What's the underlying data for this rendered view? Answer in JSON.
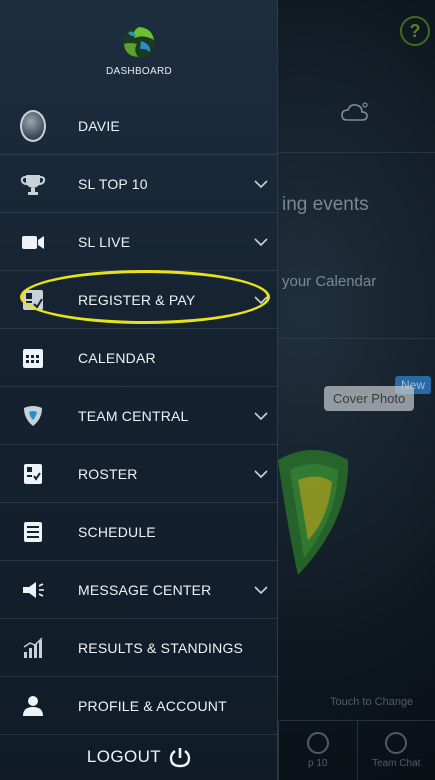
{
  "app": {
    "dashboard_label": "DASHBOARD",
    "brand_color": "#5aa32a",
    "highlight_color": "#e8e21a"
  },
  "menu": {
    "items": [
      {
        "label": "DAVIE",
        "icon": "avatar",
        "expandable": false
      },
      {
        "label": "SL TOP 10",
        "icon": "trophy-icon",
        "expandable": true
      },
      {
        "label": "SL LIVE",
        "icon": "video-camera-icon",
        "expandable": true
      },
      {
        "label": "REGISTER & PAY",
        "icon": "register-pay-icon",
        "expandable": true,
        "highlighted": true
      },
      {
        "label": "CALENDAR",
        "icon": "calendar-icon",
        "expandable": false
      },
      {
        "label": "TEAM CENTRAL",
        "icon": "team-shield-icon",
        "expandable": true
      },
      {
        "label": "ROSTER",
        "icon": "roster-icon",
        "expandable": true
      },
      {
        "label": "SCHEDULE",
        "icon": "schedule-list-icon",
        "expandable": false
      },
      {
        "label": "MESSAGE CENTER",
        "icon": "megaphone-icon",
        "expandable": true
      },
      {
        "label": "RESULTS & STANDINGS",
        "icon": "bar-chart-icon",
        "expandable": false
      },
      {
        "label": "PROFILE & ACCOUNT",
        "icon": "person-icon",
        "expandable": false
      }
    ],
    "logout_label": "LOGOUT"
  },
  "background": {
    "help_label": "?",
    "events_text": "ing events",
    "calendar_text": "your Calendar",
    "new_badge": "New",
    "cover_photo_button": "Cover Photo",
    "touch_to_change": "Touch to Change",
    "tabs": [
      "p 10",
      "Team Chat"
    ]
  }
}
